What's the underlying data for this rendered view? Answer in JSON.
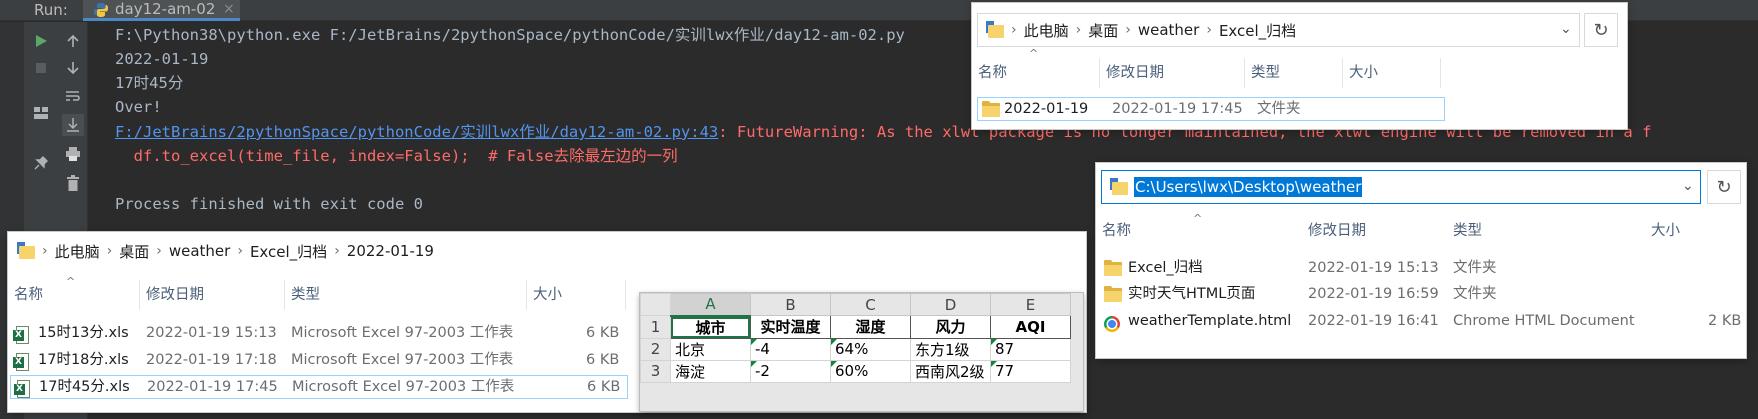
{
  "run_panel": {
    "label": "Run:",
    "tab_name": "day12-am-02",
    "tab_close": "×",
    "lines": [
      "F:\\Python38\\python.exe F:/JetBrains/2pythonSpace/pythonCode/实训lwx作业/day12-am-02.py",
      "2022-01-19",
      "17时45分",
      "Over!"
    ],
    "warning_link": "F:/JetBrains/2pythonSpace/pythonCode/实训lwx作业/day12-am-02.py:43",
    "warning_text": ": FutureWarning: As the xlwt package is no longer maintained, the xlwt engine will be removed in a f",
    "warning_code": "  df.to_excel(time_file, index=False);  # False去除最左边的一列",
    "process_line": "Process finished with exit code 0"
  },
  "explorer_top": {
    "breadcrumbs": [
      "此电脑",
      "桌面",
      "weather",
      "Excel_归档"
    ],
    "columns": [
      "名称",
      "修改日期",
      "类型",
      "大小"
    ],
    "rows": [
      {
        "name": "2022-01-19",
        "date": "2022-01-19 17:45",
        "type": "文件夹",
        "size": ""
      }
    ]
  },
  "explorer_left": {
    "breadcrumbs": [
      "此电脑",
      "桌面",
      "weather",
      "Excel_归档",
      "2022-01-19"
    ],
    "columns": [
      "名称",
      "修改日期",
      "类型",
      "大小"
    ],
    "rows": [
      {
        "name": "15时13分.xls",
        "date": "2022-01-19 15:13",
        "type": "Microsoft Excel 97-2003 工作表",
        "size": "6 KB"
      },
      {
        "name": "17时18分.xls",
        "date": "2022-01-19 17:18",
        "type": "Microsoft Excel 97-2003 工作表",
        "size": "6 KB"
      },
      {
        "name": "17时45分.xls",
        "date": "2022-01-19 17:45",
        "type": "Microsoft Excel 97-2003 工作表",
        "size": "6 KB"
      }
    ]
  },
  "explorer_right": {
    "address_value": "C:\\Users\\lwx\\Desktop\\weather",
    "columns": [
      "名称",
      "修改日期",
      "类型",
      "大小"
    ],
    "rows": [
      {
        "name": "Excel_归档",
        "date": "2022-01-19 15:13",
        "type": "文件夹",
        "size": ""
      },
      {
        "name": "实时天气HTML页面",
        "date": "2022-01-19 16:59",
        "type": "文件夹",
        "size": ""
      },
      {
        "name": "weatherTemplate.html",
        "date": "2022-01-19 16:41",
        "type": "Chrome HTML Document",
        "size": "2 KB"
      }
    ]
  },
  "spreadsheet": {
    "col_headers": [
      "A",
      "B",
      "C",
      "D",
      "E"
    ],
    "row_headers": [
      "1",
      "2",
      "3"
    ],
    "header_row": [
      "城市",
      "实时温度",
      "湿度",
      "风力",
      "AQI"
    ],
    "rows": [
      [
        "北京",
        "-4",
        "64%",
        "东方1级",
        "87"
      ],
      [
        "海淀",
        "-2",
        "60%",
        "西南风2级",
        "77"
      ]
    ]
  },
  "colors": {
    "console_bg": "#2b2b2b",
    "console_text": "#a9b7c6",
    "error_text": "#ff6b68",
    "link": "#5394ec",
    "excel_green": "#217346",
    "address_highlight": "#0078d7"
  }
}
